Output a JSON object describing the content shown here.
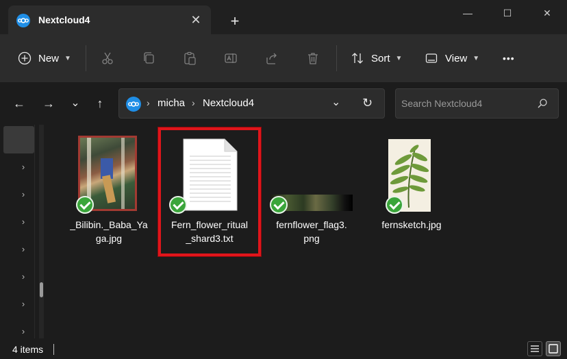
{
  "window": {
    "tab_title": "Nextcloud4",
    "tab_close_glyph": "✕",
    "new_tab_glyph": "+",
    "minimize_glyph": "—",
    "maximize_glyph": "☐",
    "close_glyph": "✕"
  },
  "toolbar": {
    "new_label": "New",
    "sort_label": "Sort",
    "view_label": "View",
    "more_glyph": "•••",
    "icons": [
      "plus-icon",
      "cut-icon",
      "copy-icon",
      "paste-icon",
      "rename-icon",
      "share-icon",
      "delete-icon",
      "sort-icon",
      "view-icon"
    ]
  },
  "navigation": {
    "back_glyph": "←",
    "forward_glyph": "→",
    "recent_glyph": "⌄",
    "up_glyph": "↑"
  },
  "address": {
    "crumbs": [
      "micha",
      "Nextcloud4"
    ],
    "separator": "›",
    "dropdown_glyph": "⌄",
    "refresh_glyph": "↻"
  },
  "search": {
    "placeholder": "Search Nextcloud4"
  },
  "sidebar": {
    "expand_glyph": "›"
  },
  "files": [
    {
      "name_line1": "_Bilibin._Baba_Ya",
      "name_line2": "ga.jpg",
      "sync_status": "synced"
    },
    {
      "name_line1": "Fern_flower_ritual",
      "name_line2": "_shard3.txt",
      "sync_status": "synced",
      "selected": true
    },
    {
      "name_line1": "fernflower_flag3.",
      "name_line2": "png",
      "sync_status": "synced"
    },
    {
      "name_line1": "fernsketch.jpg",
      "name_line2": "",
      "sync_status": "synced"
    }
  ],
  "status": {
    "item_count": "4 items"
  },
  "colors": {
    "accent": "#1f8ee6",
    "sync_ok": "#3aa53a",
    "highlight": "#e0151b"
  }
}
